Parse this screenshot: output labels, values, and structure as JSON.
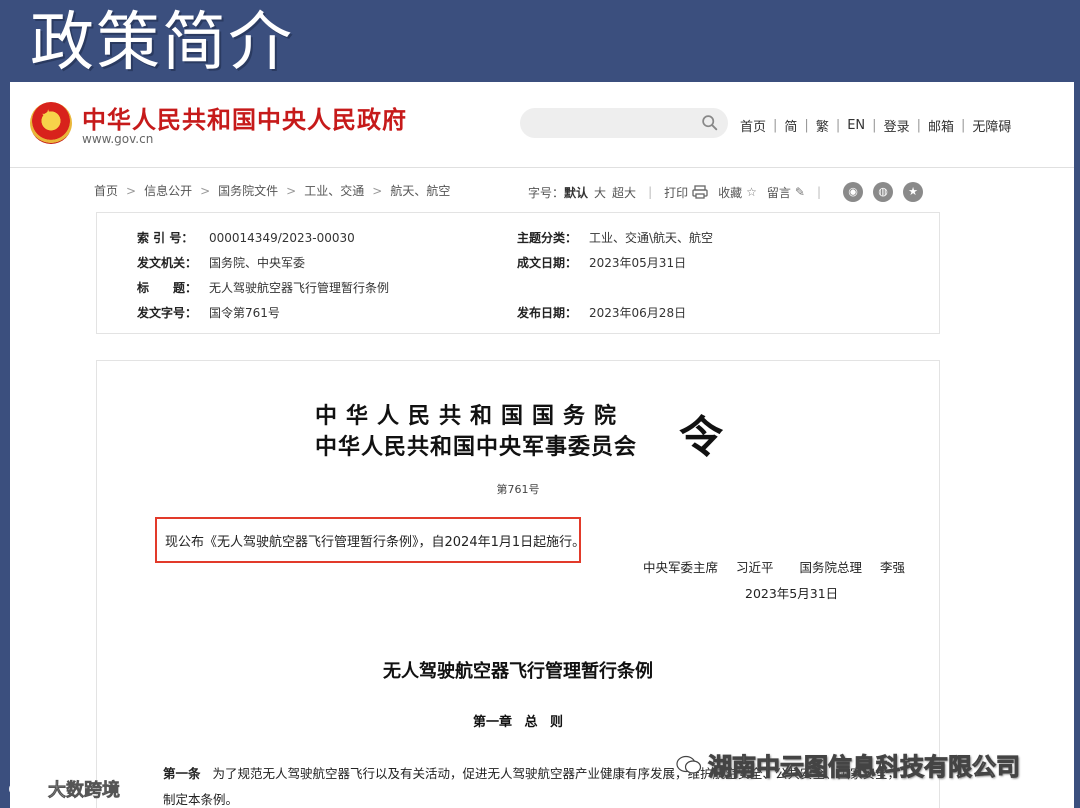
{
  "slide": {
    "title": "政策简介"
  },
  "header": {
    "site_name": "中华人民共和国中央人民政府",
    "site_url": "www.gov.cn",
    "nav": [
      "首页",
      "简",
      "繁",
      "EN",
      "登录",
      "邮箱",
      "无障碍"
    ]
  },
  "breadcrumb": [
    "首页",
    "信息公开",
    "国务院文件",
    "工业、交通",
    "航天、航空"
  ],
  "tools": {
    "font_label": "字号：",
    "font_default": "默认",
    "font_large": "大",
    "font_xlarge": "超大",
    "print": "打印",
    "favorite": "收藏",
    "comment": "留言"
  },
  "meta": {
    "index_key": "索 引 号：",
    "index_val": "000014349/2023-00030",
    "topic_key": "主题分类：",
    "topic_val": "工业、交通\\航天、航空",
    "issuer_key": "发文机关：",
    "issuer_val": "国务院、中央军委",
    "created_key": "成文日期：",
    "created_val": "2023年05月31日",
    "title_key": "标　　题：",
    "title_val": "无人驾驶航空器飞行管理暂行条例",
    "docno_key": "发文字号：",
    "docno_val": "国令第761号",
    "published_key": "发布日期：",
    "published_val": "2023年06月28日"
  },
  "document": {
    "issuer_line1": "中华人民共和国国务院",
    "issuer_line2": "中华人民共和国中央军事委员会",
    "order_char": "令",
    "doc_no": "第761号",
    "promulgation": "现公布《无人驾驶航空器飞行管理暂行条例》，自2024年1月1日起施行。",
    "signer1_title": "中央军委主席",
    "signer1_name": "习近平",
    "signer2_title": "国务院总理",
    "signer2_name": "李强",
    "sign_date": "2023年5月31日",
    "regulation_title": "无人驾驶航空器飞行管理暂行条例",
    "chapter": "第一章 总 则",
    "article_no": "第一条",
    "article_text": "为了规范无人驾驶航空器飞行以及有关活动，促进无人驾驶航空器产业健康有序发展，维护航空安全、公共安全、国家安全，制定本条例。"
  },
  "watermarks": {
    "right": "湖南中云图信息科技有限公司",
    "left": "大数跨境"
  },
  "colors": {
    "slide_bg": "#3b4f7e",
    "brand_red": "#c61a1a",
    "highlight_border": "#e23a2a"
  }
}
